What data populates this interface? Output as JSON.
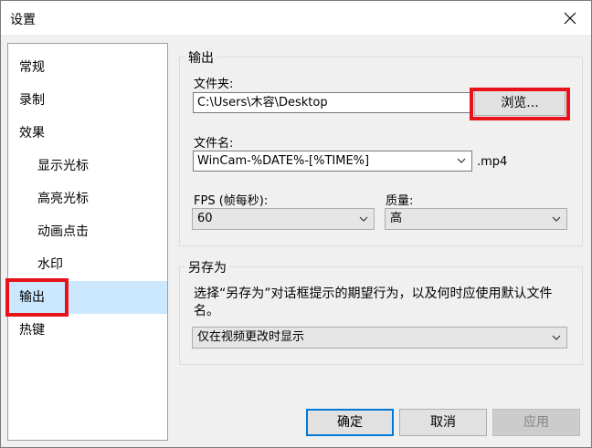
{
  "window": {
    "title": "设置"
  },
  "sidebar": {
    "items": [
      {
        "label": "常规"
      },
      {
        "label": "录制"
      },
      {
        "label": "效果"
      },
      {
        "label": "显示光标"
      },
      {
        "label": "高亮光标"
      },
      {
        "label": "动画点击"
      },
      {
        "label": "水印"
      },
      {
        "label": "输出"
      },
      {
        "label": "热键"
      }
    ],
    "selected": "输出"
  },
  "output_group": {
    "title": "输出",
    "folder_label": "文件夹:",
    "folder_value": "C:\\Users\\木容\\Desktop",
    "browse_label": "浏览...",
    "filename_label": "文件名:",
    "filename_value": "WinCam-%DATE%-[%TIME%]",
    "extension": ".mp4",
    "fps_label": "FPS (帧每秒):",
    "fps_value": "60",
    "quality_label": "质量:",
    "quality_value": "高"
  },
  "saveas_group": {
    "title": "另存为",
    "description": "选择“另存为”对话框提示的期望行为，以及何时应使用默认文件名。",
    "option_value": "仅在视频更改时显示"
  },
  "footer": {
    "ok_label": "确定",
    "cancel_label": "取消",
    "apply_label": "应用"
  },
  "colors": {
    "highlight": "#e8131a",
    "selection": "#cce8ff",
    "default_button_border": "#0078d7"
  },
  "icons": [
    "close-icon",
    "chevron-down-icon"
  ]
}
